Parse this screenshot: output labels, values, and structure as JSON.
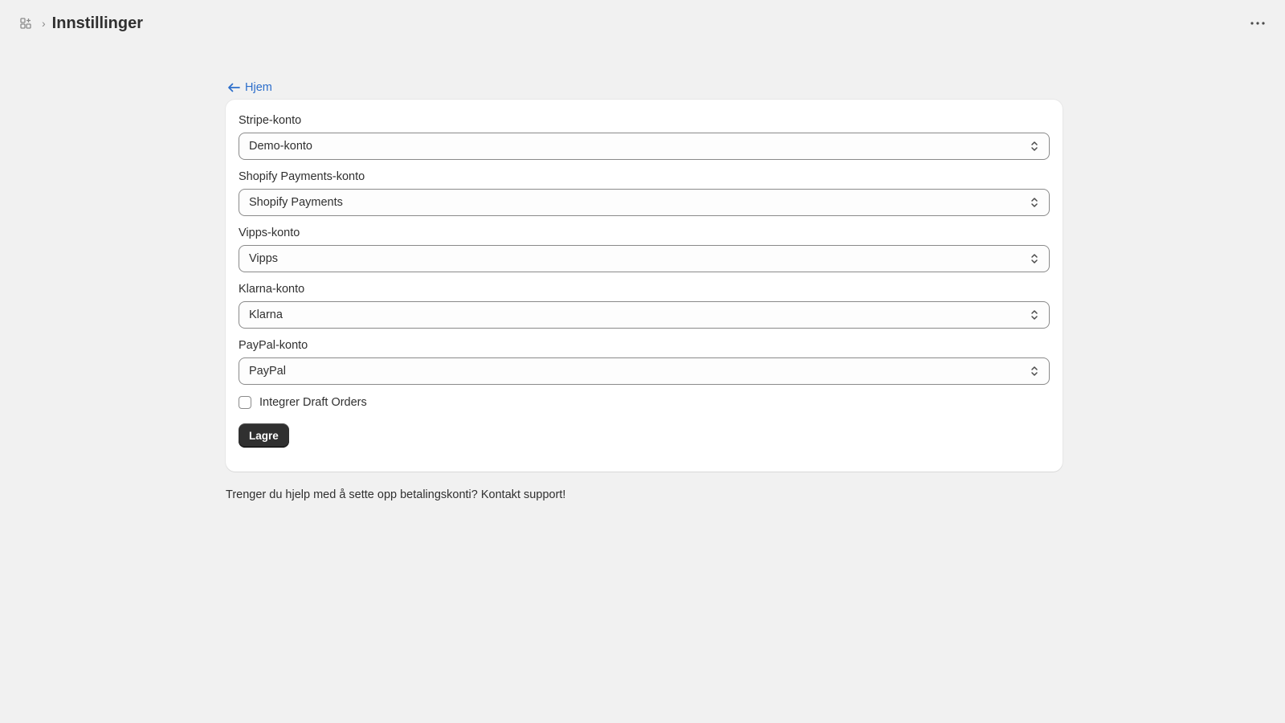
{
  "header": {
    "app_icon": "apps-grid-icon",
    "separator": "›",
    "title": "Innstillinger",
    "more_icon": "ellipsis-horizontal-icon"
  },
  "back_link": {
    "icon": "arrow-left-icon",
    "label": "Hjem"
  },
  "form": {
    "fields": [
      {
        "label": "Stripe-konto",
        "value": "Demo-konto"
      },
      {
        "label": "Shopify Payments-konto",
        "value": "Shopify Payments"
      },
      {
        "label": "Vipps-konto",
        "value": "Vipps"
      },
      {
        "label": "Klarna-konto",
        "value": "Klarna"
      },
      {
        "label": "PayPal-konto",
        "value": "PayPal"
      }
    ],
    "checkbox": {
      "label": "Integrer Draft Orders",
      "checked": false
    },
    "save_label": "Lagre"
  },
  "help_text": "Trenger du hjelp med å sette opp betalingskonti? Kontakt support!",
  "colors": {
    "background": "#f1f1f1",
    "link": "#2c6ecb",
    "primary_button": "#303030"
  }
}
